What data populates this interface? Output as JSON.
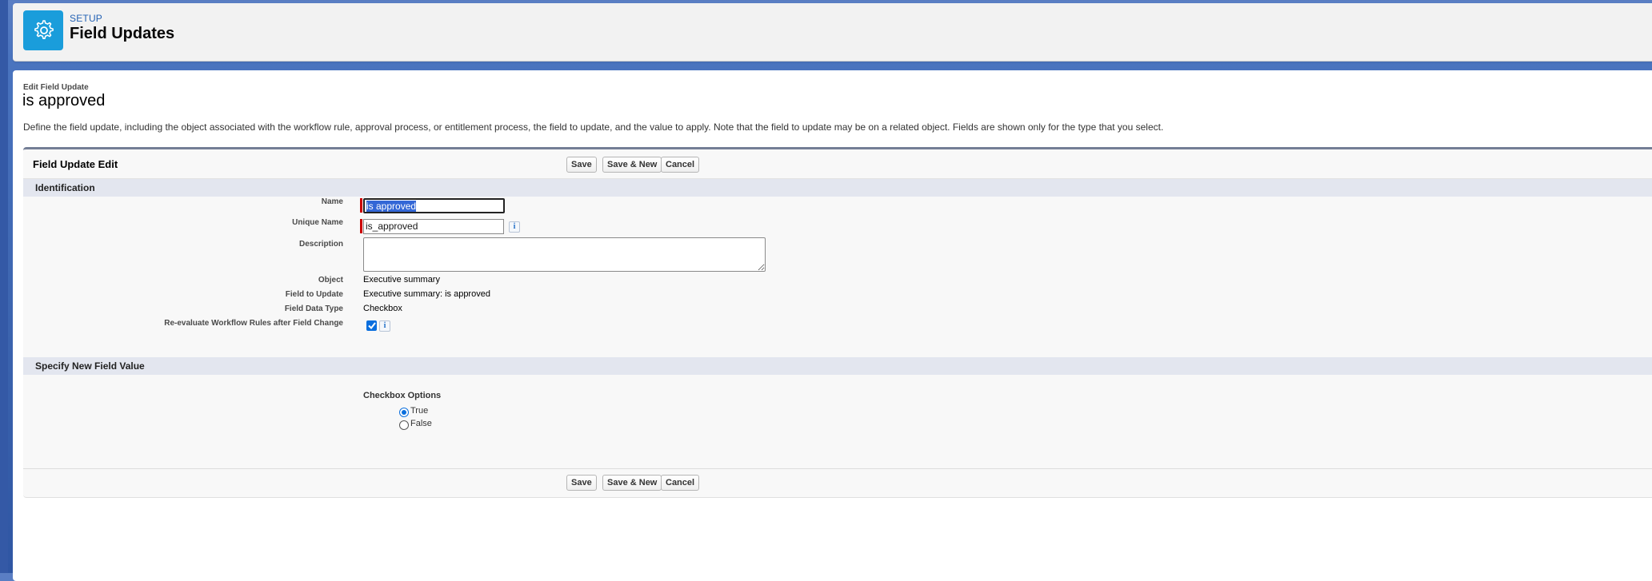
{
  "header": {
    "eyebrow": "SETUP",
    "title": "Field Updates",
    "icon": "gear-icon",
    "accent_color": "#1a9ddb"
  },
  "page": {
    "edit_label": "Edit Field Update",
    "record_title": "is approved",
    "intro": "Define the field update, including the object associated with the workflow rule, approval process, or entitlement process, the field to update, and the value to apply. Note that the field to update may be on a related object. Fields are shown only for the type that you select."
  },
  "block": {
    "title": "Field Update Edit",
    "buttons": {
      "save": "Save",
      "save_new": "Save & New",
      "cancel": "Cancel"
    }
  },
  "identification": {
    "section_title": "Identification",
    "name_label": "Name",
    "name_value": "is approved",
    "unique_name_label": "Unique Name",
    "unique_name_value": "is_approved",
    "description_label": "Description",
    "description_value": "",
    "object_label": "Object",
    "object_value": "Executive summary",
    "field_to_update_label": "Field to Update",
    "field_to_update_value": "Executive summary: is approved",
    "field_data_type_label": "Field Data Type",
    "field_data_type_value": "Checkbox",
    "reevaluate_label": "Re-evaluate Workflow Rules after Field Change",
    "reevaluate_checked": true,
    "info_glyph": "i"
  },
  "new_value": {
    "section_title": "Specify New Field Value",
    "options_label": "Checkbox Options",
    "options": [
      {
        "label": "True",
        "selected": true
      },
      {
        "label": "False",
        "selected": false
      }
    ]
  }
}
